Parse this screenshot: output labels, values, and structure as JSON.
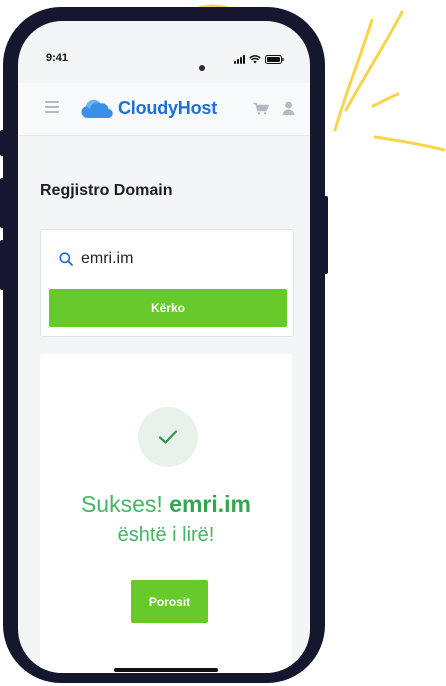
{
  "status_bar": {
    "time": "9:41"
  },
  "header": {
    "brand": "CloudyHost",
    "brand_color": "#1e6fd9"
  },
  "page": {
    "title": "Regjistro Domain"
  },
  "search": {
    "value": "emri.im",
    "button_label": "Kërko"
  },
  "result": {
    "prefix": "Sukses!",
    "domain": "emri.im",
    "suffix": "është i lirë!",
    "button_label": "Porosit",
    "color": "#44b562"
  },
  "accent_color": "#68c92a"
}
